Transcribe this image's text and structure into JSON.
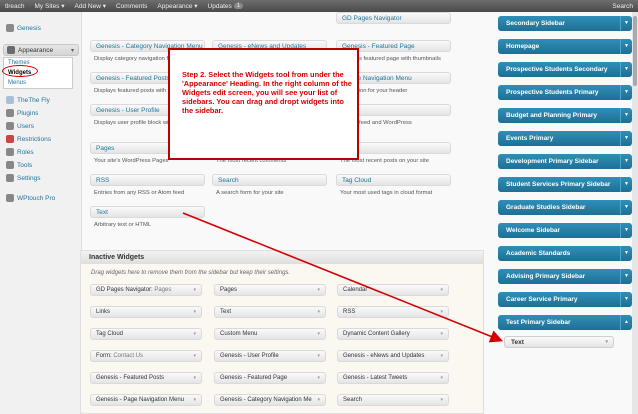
{
  "admin_bar": {
    "site": "tlreach",
    "my_sites": "My Sites",
    "add_new": "Add New",
    "comments": "Comments",
    "appearance": "Appearance",
    "updates": "Updates",
    "updates_count": "1",
    "search": "Search"
  },
  "admin_menu": {
    "items": [
      {
        "label": "Genesis",
        "color": "#8a8a8a"
      },
      {
        "label": "Appearance",
        "color": "#6b6b6b"
      },
      {
        "label": "TheThe Fly",
        "color": "#a8c0d8"
      },
      {
        "label": "Plugins",
        "color": "#888"
      },
      {
        "label": "Users",
        "color": "#888"
      },
      {
        "label": "Restrictions",
        "color": "#c44"
      },
      {
        "label": "Roles",
        "color": "#888"
      },
      {
        "label": "Tools",
        "color": "#888"
      },
      {
        "label": "Settings",
        "color": "#888"
      },
      {
        "label": "WPtouch Pro",
        "color": "#888"
      }
    ],
    "submenu": [
      "Themes",
      "Widgets",
      "Menus"
    ]
  },
  "available_widgets": [
    {
      "title": "GD Pages Navigator",
      "desc": ""
    },
    {
      "title": "Genesis - Category Navigation Menu",
      "desc": "Display category navigation for"
    },
    {
      "title": "Genesis - eNews and Updates",
      "desc": ""
    },
    {
      "title": "Genesis - Featured Page",
      "desc": "Displays featured page with thumbnails"
    },
    {
      "title": "Genesis - Featured Posts",
      "desc": "Displays featured posts with"
    },
    {
      "title": "- Page Navigation Menu",
      "desc": "navigation for your header"
    },
    {
      "title": "Genesis - User Profile",
      "desc": "Displays user profile block wit"
    },
    {
      "title": "",
      "desc": "admin, feed and WordPress"
    },
    {
      "title": "Pages",
      "desc": "Your site's WordPress Pages"
    },
    {
      "title": "",
      "desc": "The most recent comments"
    },
    {
      "title": "Posts",
      "desc": "The most recent posts on your site"
    },
    {
      "title": "RSS",
      "desc": "Entries from any RSS or Atom feed"
    },
    {
      "title": "Search",
      "desc": "A search form for your site"
    },
    {
      "title": "Tag Cloud",
      "desc": "Your most used tags in cloud format"
    },
    {
      "title": "Text",
      "desc": "Arbitrary text or HTML"
    }
  ],
  "callout": {
    "text": "Step 2. Select the Widgets tool from under the 'Appearance' Heading. In the right column of the Widgets edit screen, you will see your list of sidebars. You can drag and dropt widgets into the sidebar."
  },
  "inactive": {
    "title": "Inactive Widgets",
    "desc": "Drag widgets here to remove them from the sidebar but keep their settings.",
    "widgets": [
      {
        "title": "GD Pages Navigator:",
        "sub": "Pages"
      },
      {
        "title": "Pages",
        "sub": ""
      },
      {
        "title": "Calendar",
        "sub": ""
      },
      {
        "title": "Links",
        "sub": ""
      },
      {
        "title": "Text",
        "sub": ""
      },
      {
        "title": "RSS",
        "sub": ""
      },
      {
        "title": "Tag Cloud",
        "sub": ""
      },
      {
        "title": "Custom Menu",
        "sub": ""
      },
      {
        "title": "Dynamic Content Gallery",
        "sub": ""
      },
      {
        "title": "Form:",
        "sub": "Contact Us"
      },
      {
        "title": "Genesis - User Profile",
        "sub": ""
      },
      {
        "title": "Genesis - eNews and Updates",
        "sub": ""
      },
      {
        "title": "Genesis - Featured Posts",
        "sub": ""
      },
      {
        "title": "Genesis - Featured Page",
        "sub": ""
      },
      {
        "title": "Genesis - Latest Tweets",
        "sub": ""
      },
      {
        "title": "Genesis - Page Navigation Menu",
        "sub": ""
      },
      {
        "title": "Genesis - Category Navigation Me",
        "sub": ""
      },
      {
        "title": "Search",
        "sub": ""
      }
    ]
  },
  "sidebars": [
    "Secondary Sidebar",
    "Homepage",
    "Prospective Students Secondary",
    "Prospective Students Primary",
    "Budget and Planning Primary",
    "Events Primary",
    "Development Primary Sidebar",
    "Student Services Primary Sidebar",
    "Graduate Studies Sidebar",
    "Welcome Sidebar",
    "Academic Standards",
    "Advising Primary Sidebar",
    "Career Service Primary",
    "Test Primary Sidebar"
  ],
  "sidebar_widget": {
    "title": "Text"
  },
  "colors": {
    "accent": "#21759b",
    "sidebar_bar": "#2a82aa",
    "callout": "#d40000"
  }
}
